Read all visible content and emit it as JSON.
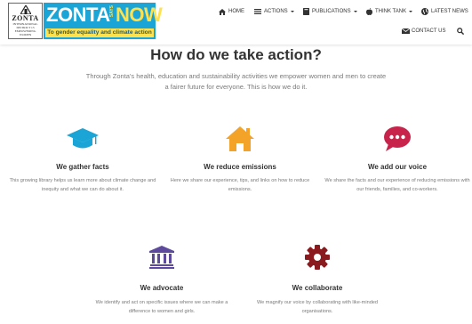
{
  "logo": {
    "left_name": "ZONTA",
    "left_lines": [
      "INTERNATIONAL",
      "DISTRICT 13",
      "EMPOWERING WOMEN"
    ],
    "brand_main": "ZONTA",
    "brand_says": "SAYS",
    "brand_now": "NOW",
    "tagline": "To gender equality and climate action"
  },
  "nav": {
    "home": "HOME",
    "actions": "ACTIONS",
    "publications": "PUBLICATIONS",
    "think_tank": "THINK TANK",
    "latest_news": "LATEST NEWS",
    "contact_us": "CONTACT US"
  },
  "main": {
    "title": "How do we take action?",
    "intro": "Through Zonta's health, education and sustainability activities we empower women and men to create a fairer future for everyone. This is how we do it."
  },
  "cards": [
    {
      "icon": "graduation-cap-icon",
      "color": "#1aa5d6",
      "title": "We gather facts",
      "text": "This growing library helps us learn more about climate change and inequity and what we can do about it."
    },
    {
      "icon": "home-icon",
      "color": "#f4a329",
      "title": "We reduce emissions",
      "text": "Here we share our experience, tips, and links on how to reduce emissions."
    },
    {
      "icon": "comments-icon",
      "color": "#c8234a",
      "title": "We add our voice",
      "text": "We share the facts and our experience of reducing emissions with our friends, families, and co-workers."
    },
    {
      "icon": "institution-icon",
      "color": "#5d4a9c",
      "title": "We advocate",
      "text": "We identify and act on specific issues where we can make a difference to women and girls."
    },
    {
      "icon": "cog-icon",
      "color": "#8b1a1f",
      "title": "We collaborate",
      "text": "We magnify our voice by collaborating with like-minded organisations."
    }
  ]
}
